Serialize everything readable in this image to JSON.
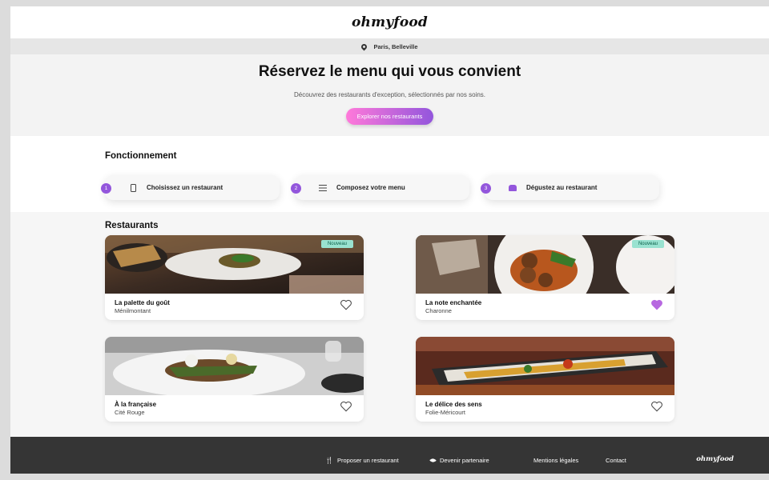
{
  "header": {
    "logo": "ohmyfood"
  },
  "location": {
    "icon": "map-pin-icon",
    "text": "Paris, Belleville"
  },
  "hero": {
    "title": "Réservez le menu qui vous convient",
    "subtitle": "Découvrez des restaurants d'exception, sélectionnés par nos soins.",
    "cta_label": "Explorer nos restaurants"
  },
  "how_it_works": {
    "title": "Fonctionnement",
    "steps": [
      {
        "number": "1",
        "icon": "phone-icon",
        "label": "Choisissez un restaurant"
      },
      {
        "number": "2",
        "icon": "list-icon",
        "label": "Composez votre menu"
      },
      {
        "number": "3",
        "icon": "food-dome-icon",
        "label": "Dégustez au restaurant"
      }
    ]
  },
  "restaurants": {
    "title": "Restaurants",
    "items": [
      {
        "name": "La palette du goût",
        "area": "Ménilmontant",
        "badge": "Nouveau",
        "liked": false
      },
      {
        "name": "La note enchantée",
        "area": "Charonne",
        "badge": "Nouveau",
        "liked": true
      },
      {
        "name": "À la française",
        "area": "Cité Rouge",
        "badge": "",
        "liked": false
      },
      {
        "name": "Le délice des sens",
        "area": "Folie-Méricourt",
        "badge": "",
        "liked": false
      }
    ]
  },
  "footer": {
    "logo": "ohmyfood",
    "propose_label": "Proposer un restaurant",
    "partner_label": "Devenir partenaire",
    "legal_label": "Mentions légales",
    "contact_label": "Contact"
  },
  "colors": {
    "accent": "#9356dc",
    "accent_pink": "#ff79da",
    "badge": "#99e2d0",
    "footer": "#353535"
  }
}
